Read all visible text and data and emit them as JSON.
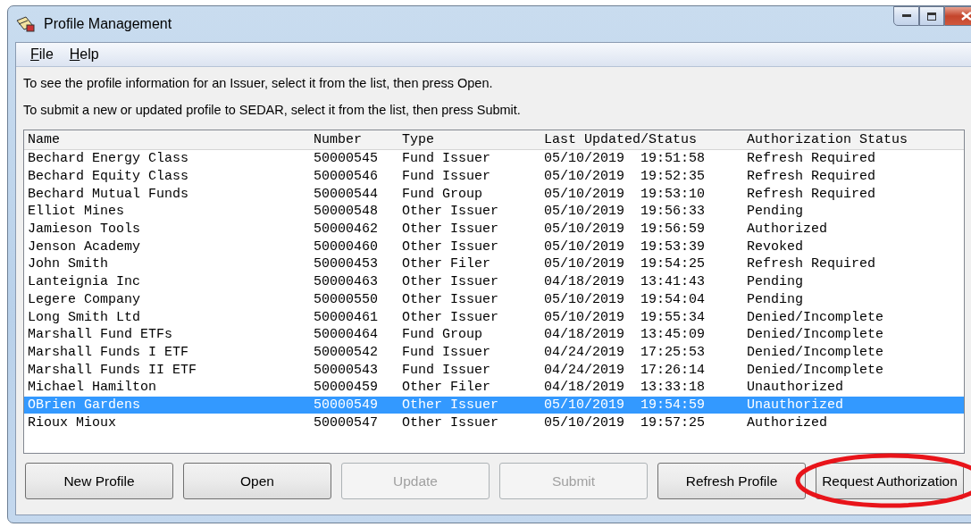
{
  "window": {
    "title": "Profile Management"
  },
  "menu": [
    {
      "label": "File"
    },
    {
      "label": "Help"
    }
  ],
  "instructions": [
    "To see the profile information for an Issuer, select it from the list, then press Open.",
    "To submit a new or updated profile to SEDAR, select it from the list, then press Submit."
  ],
  "table": {
    "columns": [
      "Name",
      "Number",
      "Type",
      "Last Updated/Status",
      "Authorization Status"
    ],
    "rows": [
      {
        "cells": [
          "Bechard Energy Class",
          "50000545",
          "Fund Issuer",
          "05/10/2019  19:51:58",
          "Refresh Required"
        ],
        "selected": false
      },
      {
        "cells": [
          "Bechard Equity Class",
          "50000546",
          "Fund Issuer",
          "05/10/2019  19:52:35",
          "Refresh Required"
        ],
        "selected": false
      },
      {
        "cells": [
          "Bechard Mutual Funds",
          "50000544",
          "Fund Group",
          "05/10/2019  19:53:10",
          "Refresh Required"
        ],
        "selected": false
      },
      {
        "cells": [
          "Elliot Mines",
          "50000548",
          "Other Issuer",
          "05/10/2019  19:56:33",
          "Pending"
        ],
        "selected": false
      },
      {
        "cells": [
          "Jamieson Tools",
          "50000462",
          "Other Issuer",
          "05/10/2019  19:56:59",
          "Authorized"
        ],
        "selected": false
      },
      {
        "cells": [
          "Jenson Academy",
          "50000460",
          "Other Issuer",
          "05/10/2019  19:53:39",
          "Revoked"
        ],
        "selected": false
      },
      {
        "cells": [
          "John Smith",
          "50000453",
          "Other Filer",
          "05/10/2019  19:54:25",
          "Refresh Required"
        ],
        "selected": false
      },
      {
        "cells": [
          "Lanteignia Inc",
          "50000463",
          "Other Issuer",
          "04/18/2019  13:41:43",
          "Pending"
        ],
        "selected": false
      },
      {
        "cells": [
          "Legere Company",
          "50000550",
          "Other Issuer",
          "05/10/2019  19:54:04",
          "Pending"
        ],
        "selected": false
      },
      {
        "cells": [
          "Long Smith Ltd",
          "50000461",
          "Other Issuer",
          "05/10/2019  19:55:34",
          "Denied/Incomplete"
        ],
        "selected": false
      },
      {
        "cells": [
          "Marshall Fund ETFs",
          "50000464",
          "Fund Group",
          "04/18/2019  13:45:09",
          "Denied/Incomplete"
        ],
        "selected": false
      },
      {
        "cells": [
          "Marshall Funds I ETF",
          "50000542",
          "Fund Issuer",
          "04/24/2019  17:25:53",
          "Denied/Incomplete"
        ],
        "selected": false
      },
      {
        "cells": [
          "Marshall Funds II ETF",
          "50000543",
          "Fund Issuer",
          "04/24/2019  17:26:14",
          "Denied/Incomplete"
        ],
        "selected": false
      },
      {
        "cells": [
          "Michael Hamilton",
          "50000459",
          "Other Filer",
          "04/18/2019  13:33:18",
          "Unauthorized"
        ],
        "selected": false
      },
      {
        "cells": [
          "OBrien Gardens",
          "50000549",
          "Other Issuer",
          "05/10/2019  19:54:59",
          "Unauthorized"
        ],
        "selected": true
      },
      {
        "cells": [
          "Rioux Mioux",
          "50000547",
          "Other Issuer",
          "05/10/2019  19:57:25",
          "Authorized"
        ],
        "selected": false
      }
    ]
  },
  "buttons": [
    {
      "label": "New Profile",
      "disabled": false,
      "circled": false
    },
    {
      "label": "Open",
      "disabled": false,
      "circled": false
    },
    {
      "label": "Update",
      "disabled": true,
      "circled": false
    },
    {
      "label": "Submit",
      "disabled": true,
      "circled": false
    },
    {
      "label": "Refresh Profile",
      "disabled": false,
      "circled": false
    },
    {
      "label": "Request Authorization",
      "disabled": false,
      "circled": true
    }
  ]
}
